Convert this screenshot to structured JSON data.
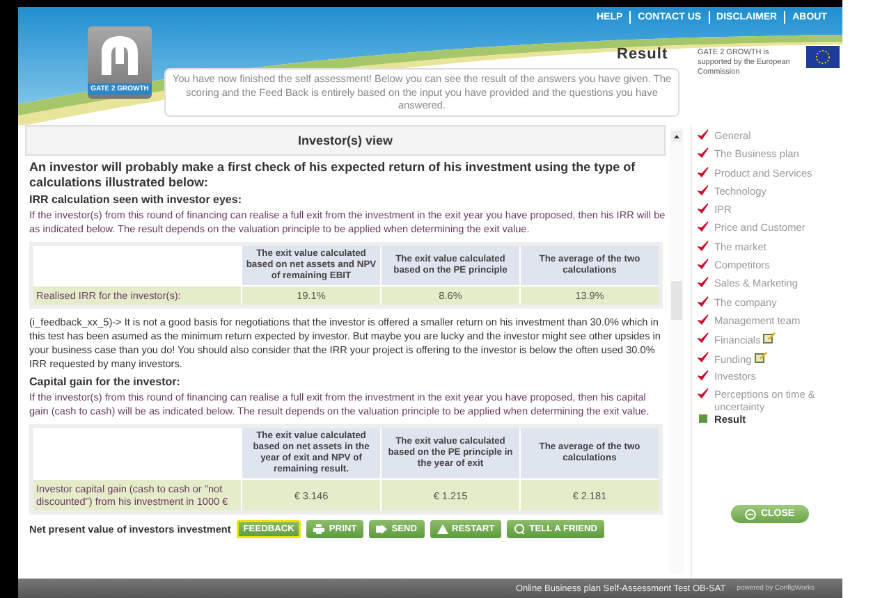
{
  "top_links": [
    "HELP",
    "CONTACT US",
    "DISCLAIMER",
    "ABOUT"
  ],
  "logo": {
    "label": "GATE 2 GROWTH"
  },
  "page_title": "Result",
  "intro": "You have now finished the self assessment! Below you can see the result of the answers you have given. The scoring and the Feed Back is entirely based on the input you have provided and the questions you have answered.",
  "sponsor": {
    "text": "GATE 2 GROWTH is supported by the European Commission"
  },
  "panel": {
    "title": "Investor(s) view",
    "blocks": [
      {
        "kind": "lead",
        "text": "An investor will probably make a first check of his expected return of his investment using the type of calculations illustrated below:"
      },
      {
        "kind": "heading",
        "text": "IRR calculation seen with investor eyes:"
      },
      {
        "kind": "paragraph",
        "text": "If the investor(s) from this round of financing can realise a full exit from the investment in the exit year you have proposed, then his IRR will be as indicated below. The result depends on the valuation principle to be applied when determining the exit value."
      },
      {
        "kind": "table",
        "columns": [
          "The exit value calculated based on net assets and NPV of remaining EBIT",
          "The exit value calculated based on the PE principle",
          "The average of the two calculations"
        ],
        "row": {
          "label": "Realised IRR for the investor(s):",
          "values": [
            "19.1%",
            "8.6%",
            "13.9%"
          ]
        }
      },
      {
        "kind": "feedback",
        "text": "(i_feedback_xx_5)-> It is not a good basis for negotiations that the investor is offered a smaller return on his investment than 30.0% which in this test has been asumed as the minimum return expected by investor. But maybe you are lucky and the investor might see other upsides in your business case than you do! You should also consider that the IRR your project is offering to the investor is below the often used 30.0% IRR requested by many investors."
      },
      {
        "kind": "heading",
        "text": "Capital gain for the investor:"
      },
      {
        "kind": "paragraph",
        "text": "If the investor(s) from this round of financing can realise a full exit from the investment in the exit year you have proposed, then his capital gain (cash to cash) will be as indicated below. The result depends on the valuation principle to be applied when determining the exit value."
      },
      {
        "kind": "table",
        "columns": [
          "The exit value calculated based on net assets in the year of exit and NPV of remaining result.",
          "The exit value calculated based on the PE principle in the year of exit",
          "The average of the two calculations"
        ],
        "row": {
          "label": "Investor capital gain (cash to cash or \"not discounted\") from his investment in 1000 €",
          "values": [
            "€ 3.146",
            "€ 1.215",
            "€ 2.181"
          ]
        }
      }
    ],
    "last_heading": "Net present value of investors investment"
  },
  "buttons": [
    {
      "kind": "feedback",
      "label": "FEEDBACK",
      "focused": true
    },
    {
      "kind": "print",
      "label": "PRINT",
      "focused": false
    },
    {
      "kind": "send",
      "label": "SEND",
      "focused": false
    },
    {
      "kind": "restart",
      "label": "RESTART",
      "focused": false
    },
    {
      "kind": "tell",
      "label": "TELL A FRIEND",
      "focused": false
    }
  ],
  "sidebar": {
    "items": [
      {
        "kind": "done",
        "label": "General",
        "note": false
      },
      {
        "kind": "done",
        "label": "The Business plan",
        "note": false
      },
      {
        "kind": "done",
        "label": "Product and Services",
        "note": false
      },
      {
        "kind": "done",
        "label": "Technology",
        "note": false
      },
      {
        "kind": "done",
        "label": "IPR",
        "note": false
      },
      {
        "kind": "done",
        "label": "Price and Customer",
        "note": false
      },
      {
        "kind": "done",
        "label": "The market",
        "note": false
      },
      {
        "kind": "done",
        "label": "Competitors",
        "note": false
      },
      {
        "kind": "done",
        "label": "Sales & Marketing",
        "note": false
      },
      {
        "kind": "done",
        "label": "The company",
        "note": false
      },
      {
        "kind": "done",
        "label": "Management team",
        "note": false
      },
      {
        "kind": "done",
        "label": "Financials",
        "note": true
      },
      {
        "kind": "done",
        "label": "Funding",
        "note": true
      },
      {
        "kind": "done",
        "label": "Investors",
        "note": false
      },
      {
        "kind": "done",
        "label": "Perceptions on time & uncertainty",
        "note": false
      },
      {
        "kind": "current",
        "label": "Result",
        "note": false
      }
    ],
    "close_button": "CLOSE"
  },
  "footer": {
    "text": "Online Business plan Self-Assessment Test OB-SAT",
    "credit": "powered by ConfigWorks"
  }
}
